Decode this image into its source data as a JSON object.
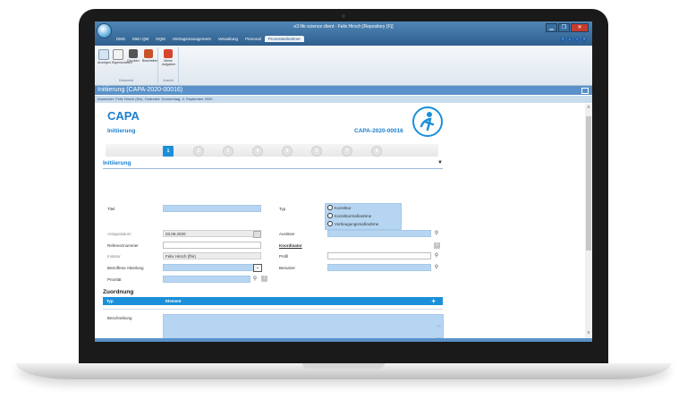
{
  "window": {
    "title": "e3 life science client - Felix Hirsch [Repository (F)]",
    "buttons": [
      "▁",
      "❐",
      "✕"
    ]
  },
  "menu": {
    "items": [
      "DMS",
      "Mein QM",
      "NQM",
      "Vertragsmanagement",
      "Verwaltung",
      "Personal",
      "Prozessteilnahme"
    ],
    "active_index": 6,
    "help_icons": [
      "?",
      "i",
      "!",
      "?"
    ]
  },
  "ribbon": {
    "groups": [
      {
        "label": "Dokument",
        "buttons": [
          "Anzeigen",
          "Eigenschaften",
          "Drucken",
          "Bearbeiten"
        ]
      },
      {
        "label": "Ansicht",
        "buttons": [
          "Meine Aufgaben"
        ]
      }
    ]
  },
  "header": {
    "title": "Initiierung (CAPA-2020-00016)",
    "info": "Anwender: Felix Hirsch (fhir), Geändert: Donnerstag, 3. September 2020"
  },
  "form": {
    "heading": "CAPA",
    "subheading": "Initiierung",
    "record_id": "CAPA-2020-00016",
    "steps": [
      "1",
      "2",
      "3",
      "4",
      "5",
      "6",
      "7",
      "8"
    ],
    "active_step": 0,
    "section_title": "Initiierung",
    "section_toggle": "▼",
    "fields": {
      "titel": {
        "label": "Titel",
        "value": ""
      },
      "typ": {
        "label": "Typ",
        "options": [
          "Korrektur",
          "Korrekturmaßnahme",
          "Vorbeugungsmaßnahme"
        ]
      },
      "anlagedatum": {
        "label": "Anlagedatum",
        "value": "03.09.2020"
      },
      "auslöser": {
        "label": "Auslöser",
        "value": ""
      },
      "referenznummer": {
        "label": "Referenznummer",
        "value": ""
      },
      "koordinator": {
        "label": "Koordinator"
      },
      "initiator": {
        "label": "Initiator",
        "value": "Felix Hirsch (fhir)"
      },
      "profil": {
        "label": "Profil",
        "value": ""
      },
      "abteilung": {
        "label": "Betroffene Abteilung",
        "value": ""
      },
      "benutzer": {
        "label": "Benutzer",
        "value": ""
      },
      "prioritaet": {
        "label": "Priorität",
        "value": ""
      }
    },
    "zuordnung": {
      "title": "Zuordnung",
      "columns": [
        "Typ",
        "Element"
      ],
      "add_label": "+"
    },
    "beschreibung": {
      "label": "Beschreibung",
      "value": ""
    }
  },
  "colors": {
    "accent": "#1b8fd9",
    "field_fill": "#b6d5f2",
    "header_bar": "#5a91c8"
  }
}
